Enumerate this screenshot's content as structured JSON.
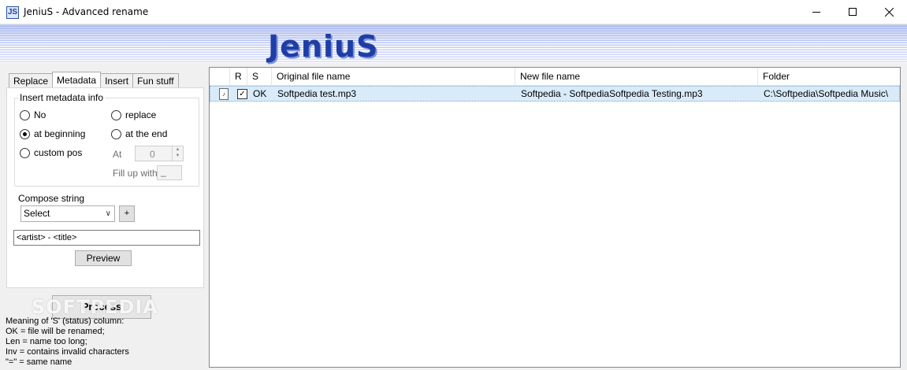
{
  "window": {
    "icon_text": "JS",
    "title": "JeniuS - Advanced rename"
  },
  "banner": {
    "logo": "JeniuS"
  },
  "tabs": [
    "Replace",
    "Metadata",
    "Insert",
    "Fun stuff"
  ],
  "metadata": {
    "group_title": "Insert metadata info",
    "options": {
      "no": "No",
      "replace": "replace",
      "at_beginning": "at beginning",
      "at_the_end": "at the end",
      "custom_pos": "custom pos"
    },
    "selected_option": "at beginning",
    "at_label": "At",
    "at_value": "0",
    "fill_label": "Fill up with",
    "fill_value": "_",
    "compose_label": "Compose string",
    "select_value": "Select",
    "plus_label": "+",
    "compose_value": "<artist> - <title>",
    "preview_label": "Preview"
  },
  "process_label": "Process",
  "watermark": "SOFTPEDIA",
  "legend": [
    "Meaning of 'S' (status) column:",
    "OK = file will be renamed;",
    "Len = name too long;",
    "Inv = contains invalid characters",
    "\"=\" = same name"
  ],
  "grid": {
    "columns": [
      "",
      "R",
      "S",
      "Original file name",
      "New file name",
      "Folder"
    ],
    "rows": [
      {
        "checked": true,
        "status": "OK",
        "original": "Softpedia test.mp3",
        "new": "Softpedia - SoftpediaSoftpedia Testing.mp3",
        "folder": "C:\\Softpedia\\Softpedia Music\\"
      }
    ]
  },
  "icons": {
    "check": "✓",
    "file": "♪",
    "dropdown": "∨",
    "spin_up": "▲",
    "spin_down": "▼"
  },
  "colors": {
    "logo": "#1e3ea6",
    "selected_row": "#d9ebf9"
  }
}
